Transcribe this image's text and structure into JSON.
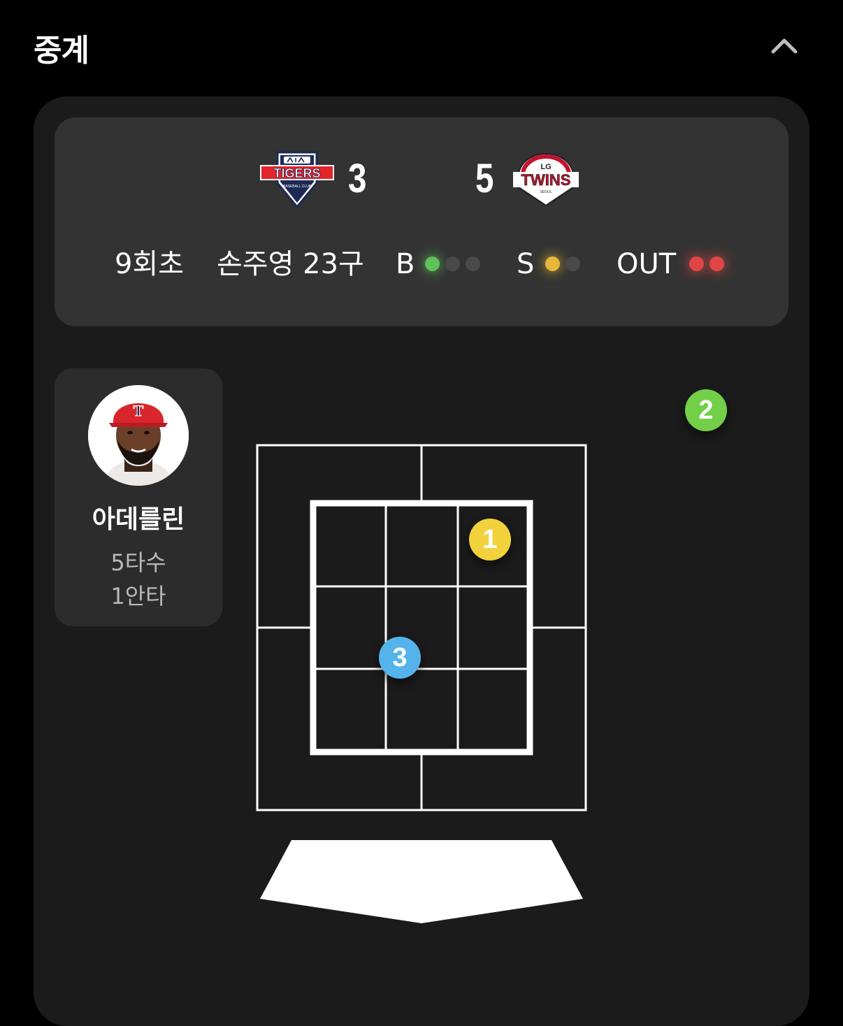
{
  "header": {
    "title": "중계"
  },
  "scoreboard": {
    "away": {
      "logo_icon": "kia-tigers-logo-icon",
      "score": "3"
    },
    "home": {
      "logo_icon": "lg-twins-logo-icon",
      "score": "5"
    },
    "inning": "9회초",
    "pitcher_pitches": "손주영 23구",
    "balls_label": "B",
    "strikes_label": "S",
    "outs_label": "OUT",
    "count": {
      "balls": 1,
      "balls_max": 3,
      "strikes": 1,
      "strikes_max": 2,
      "outs": 2,
      "outs_max": 2
    },
    "colors": {
      "ball": "#5ec15a",
      "strike": "#e7b63a",
      "out": "#e04646",
      "off": "#4a4a4a"
    }
  },
  "batter": {
    "name": "아데를린",
    "at_bats": "5타수",
    "hits": "1안타",
    "avatar_icon": "batter-avatar-icon"
  },
  "pitches": [
    {
      "number": "1",
      "color": "#f2d23c"
    },
    {
      "number": "2",
      "color": "#72cf47"
    },
    {
      "number": "3",
      "color": "#55b3ec"
    }
  ]
}
